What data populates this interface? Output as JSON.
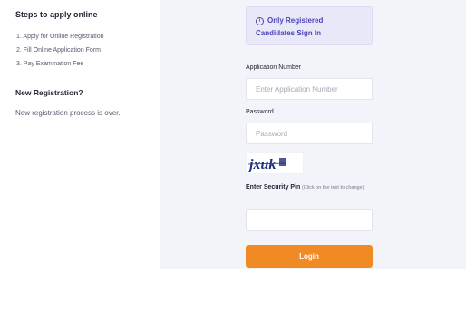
{
  "left": {
    "steps_title": "Steps to apply online",
    "steps": [
      "1. Apply for Online Registration",
      "2. Fill Online Application Form",
      "3. Pay Examination Fee"
    ],
    "new_title": "New Registration?",
    "new_text": "New registration process is over."
  },
  "notice": {
    "icon": "info-icon",
    "line1": "Only Registered",
    "line2": "Candidates Sign In"
  },
  "form": {
    "app_label": "Application Number",
    "app_placeholder": "Enter Application Number",
    "password_label": "Password",
    "password_placeholder": "Password",
    "captcha_text": "jxuk",
    "pin_label": "Enter Security Pin",
    "pin_hint": "(Click on the text to change)",
    "login_label": "Login"
  },
  "colors": {
    "accent": "#f08a24",
    "notice_text": "#4a45b8",
    "panel_bg": "#f3f3fa"
  }
}
